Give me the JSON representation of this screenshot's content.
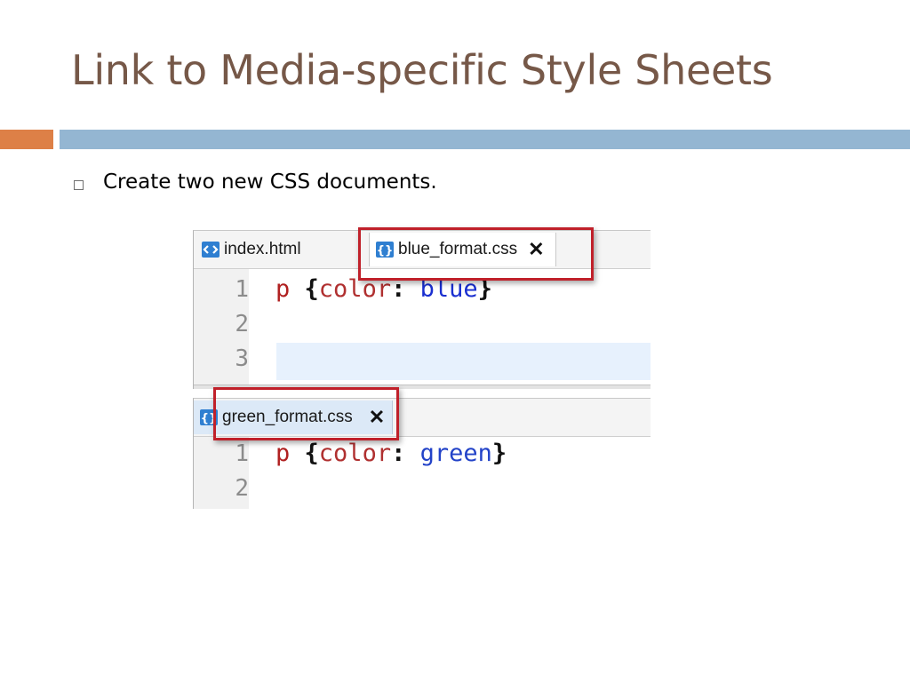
{
  "slide": {
    "title": "Link to Media-specific Style Sheets",
    "bullet": "Create two new CSS documents."
  },
  "colors": {
    "title": "#765848",
    "accent_orange": "#dd8047",
    "accent_blue": "#94b6d2",
    "callout": "#c0202a"
  },
  "editor1": {
    "tabs": [
      {
        "label": "index.html",
        "icon": "html-file-icon"
      },
      {
        "label": "blue_format.css",
        "icon": "css-file-icon",
        "close": "✕"
      }
    ],
    "lines": [
      {
        "num": "1",
        "selector": "p",
        "open": "{",
        "prop": "color",
        "colon": ":",
        "value": "blue",
        "close": "}"
      },
      {
        "num": "2"
      },
      {
        "num": "3"
      }
    ]
  },
  "editor2": {
    "tabs": [
      {
        "label": "green_format.css",
        "icon": "css-file-icon",
        "close": "✕"
      }
    ],
    "lines": [
      {
        "num": "1",
        "selector": "p",
        "open": "{",
        "prop": "color",
        "colon": ":",
        "value": "green",
        "close": "}"
      },
      {
        "num": "2"
      }
    ]
  }
}
